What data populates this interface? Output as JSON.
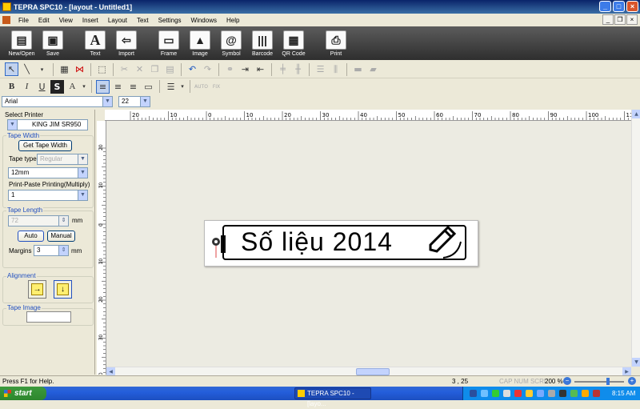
{
  "window": {
    "title": "TEPRA SPC10 - [layout - Untitled1]"
  },
  "menu": [
    "File",
    "Edit",
    "View",
    "Insert",
    "Layout",
    "Text",
    "Settings",
    "Windows",
    "Help"
  ],
  "big_toolbar": [
    {
      "label": "New/Open",
      "icon": "new-open-icon"
    },
    {
      "label": "Save",
      "icon": "floppy-icon"
    },
    {
      "label": "Text",
      "icon": "text-A-icon"
    },
    {
      "label": "Import",
      "icon": "import-icon"
    },
    {
      "label": "Frame",
      "icon": "frame-icon"
    },
    {
      "label": "Image",
      "icon": "image-icon"
    },
    {
      "label": "Symbol",
      "icon": "symbol-icon"
    },
    {
      "label": "Barcode",
      "icon": "barcode-icon"
    },
    {
      "label": "QR Code",
      "icon": "qrcode-icon"
    },
    {
      "label": "Print",
      "icon": "printer-icon"
    }
  ],
  "font": {
    "name": "Arial",
    "size": "22"
  },
  "panel": {
    "select_printer_title": "Select Printer",
    "printer": "KING JIM SR950",
    "tape_width_title": "Tape Width",
    "get_tape_width": "Get Tape Width",
    "tape_type_label": "Tape type",
    "tape_type_value": "Regular",
    "tape_width_value": "12mm",
    "print_paste_label": "Print-Paste Printing(Multiply)",
    "print_paste_value": "1",
    "tape_length_title": "Tape Length",
    "tape_length_value": "72",
    "tape_length_unit": "mm",
    "auto_label": "Auto",
    "manual_label": "Manual",
    "margins_label": "Margins",
    "margins_value": "3",
    "margins_unit": "mm",
    "alignment_title": "Alignment",
    "tape_image_title": "Tape Image"
  },
  "ruler": {
    "h_labels": [
      "20",
      "10",
      "0",
      "10",
      "20",
      "30",
      "40",
      "50",
      "60",
      "70",
      "80",
      "90",
      "100",
      "110"
    ],
    "v_labels": [
      "20",
      "10",
      "0",
      "10",
      "20",
      "30",
      "40"
    ]
  },
  "label_text": "Số liệu 2014",
  "status": {
    "help": "Press F1 for Help.",
    "position": "3 , 25",
    "indicators": "CAP NUM SCRL",
    "zoom": "200 %"
  },
  "taskbar": {
    "start": "start",
    "task": "TEPRA SPC10 - [layo...",
    "clock": "8:15 AM"
  }
}
